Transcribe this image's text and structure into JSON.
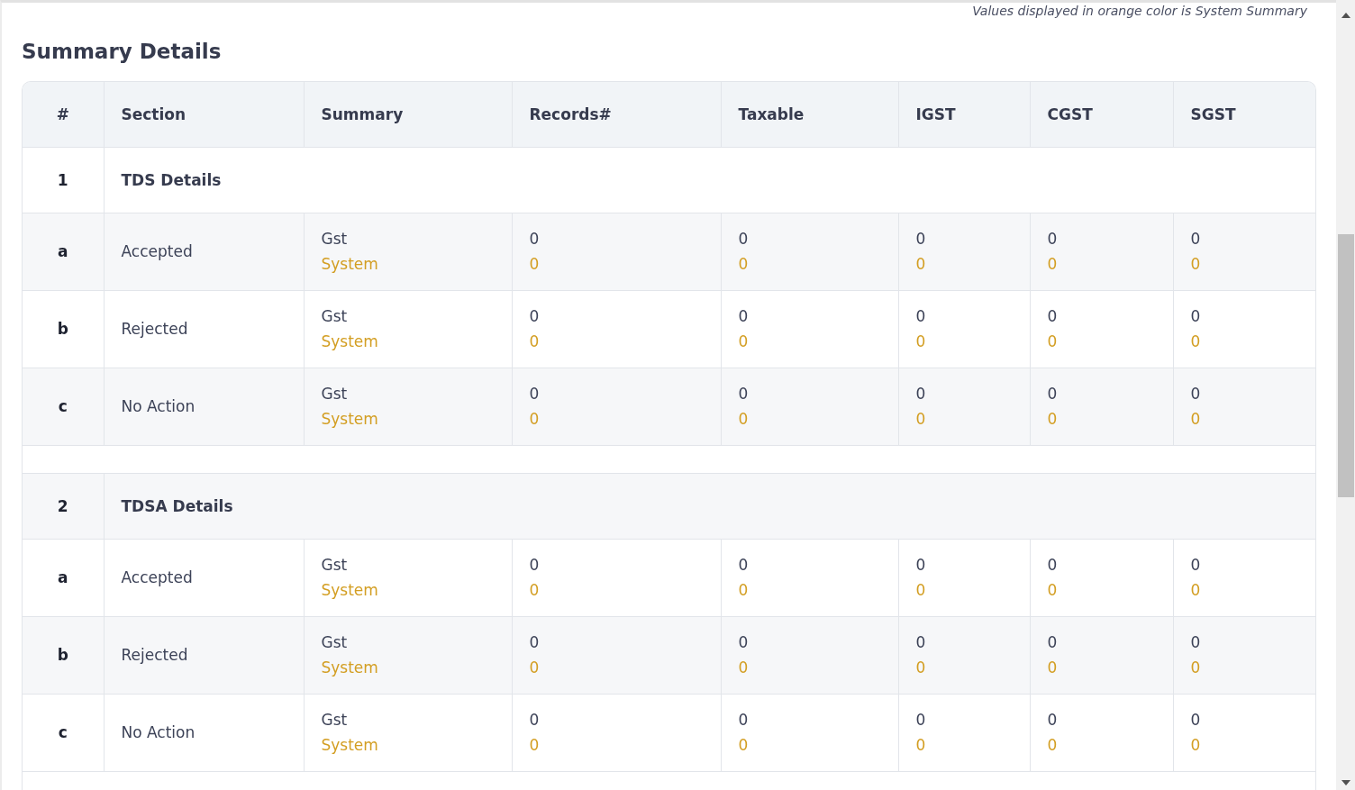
{
  "note": "Values displayed in orange color is System Summary",
  "title": "Summary Details",
  "table": {
    "columns": [
      "#",
      "Section",
      "Summary",
      "Records#",
      "Taxable",
      "IGST",
      "CGST",
      "SGST"
    ],
    "groups": [
      {
        "number": "1",
        "title": "TDS Details",
        "rows": [
          {
            "label": "a",
            "section": "Accepted",
            "summary": {
              "gst": "Gst",
              "system": "System"
            },
            "values": [
              {
                "gst": "0",
                "system": "0"
              },
              {
                "gst": "0",
                "system": "0"
              },
              {
                "gst": "0",
                "system": "0"
              },
              {
                "gst": "0",
                "system": "0"
              },
              {
                "gst": "0",
                "system": "0"
              }
            ]
          },
          {
            "label": "b",
            "section": "Rejected",
            "summary": {
              "gst": "Gst",
              "system": "System"
            },
            "values": [
              {
                "gst": "0",
                "system": "0"
              },
              {
                "gst": "0",
                "system": "0"
              },
              {
                "gst": "0",
                "system": "0"
              },
              {
                "gst": "0",
                "system": "0"
              },
              {
                "gst": "0",
                "system": "0"
              }
            ]
          },
          {
            "label": "c",
            "section": "No Action",
            "summary": {
              "gst": "Gst",
              "system": "System"
            },
            "values": [
              {
                "gst": "0",
                "system": "0"
              },
              {
                "gst": "0",
                "system": "0"
              },
              {
                "gst": "0",
                "system": "0"
              },
              {
                "gst": "0",
                "system": "0"
              },
              {
                "gst": "0",
                "system": "0"
              }
            ]
          }
        ]
      },
      {
        "number": "2",
        "title": "TDSA Details",
        "rows": [
          {
            "label": "a",
            "section": "Accepted",
            "summary": {
              "gst": "Gst",
              "system": "System"
            },
            "values": [
              {
                "gst": "0",
                "system": "0"
              },
              {
                "gst": "0",
                "system": "0"
              },
              {
                "gst": "0",
                "system": "0"
              },
              {
                "gst": "0",
                "system": "0"
              },
              {
                "gst": "0",
                "system": "0"
              }
            ]
          },
          {
            "label": "b",
            "section": "Rejected",
            "summary": {
              "gst": "Gst",
              "system": "System"
            },
            "values": [
              {
                "gst": "0",
                "system": "0"
              },
              {
                "gst": "0",
                "system": "0"
              },
              {
                "gst": "0",
                "system": "0"
              },
              {
                "gst": "0",
                "system": "0"
              },
              {
                "gst": "0",
                "system": "0"
              }
            ]
          },
          {
            "label": "c",
            "section": "No Action",
            "summary": {
              "gst": "Gst",
              "system": "System"
            },
            "values": [
              {
                "gst": "0",
                "system": "0"
              },
              {
                "gst": "0",
                "system": "0"
              },
              {
                "gst": "0",
                "system": "0"
              },
              {
                "gst": "0",
                "system": "0"
              },
              {
                "gst": "0",
                "system": "0"
              }
            ]
          }
        ]
      }
    ]
  }
}
